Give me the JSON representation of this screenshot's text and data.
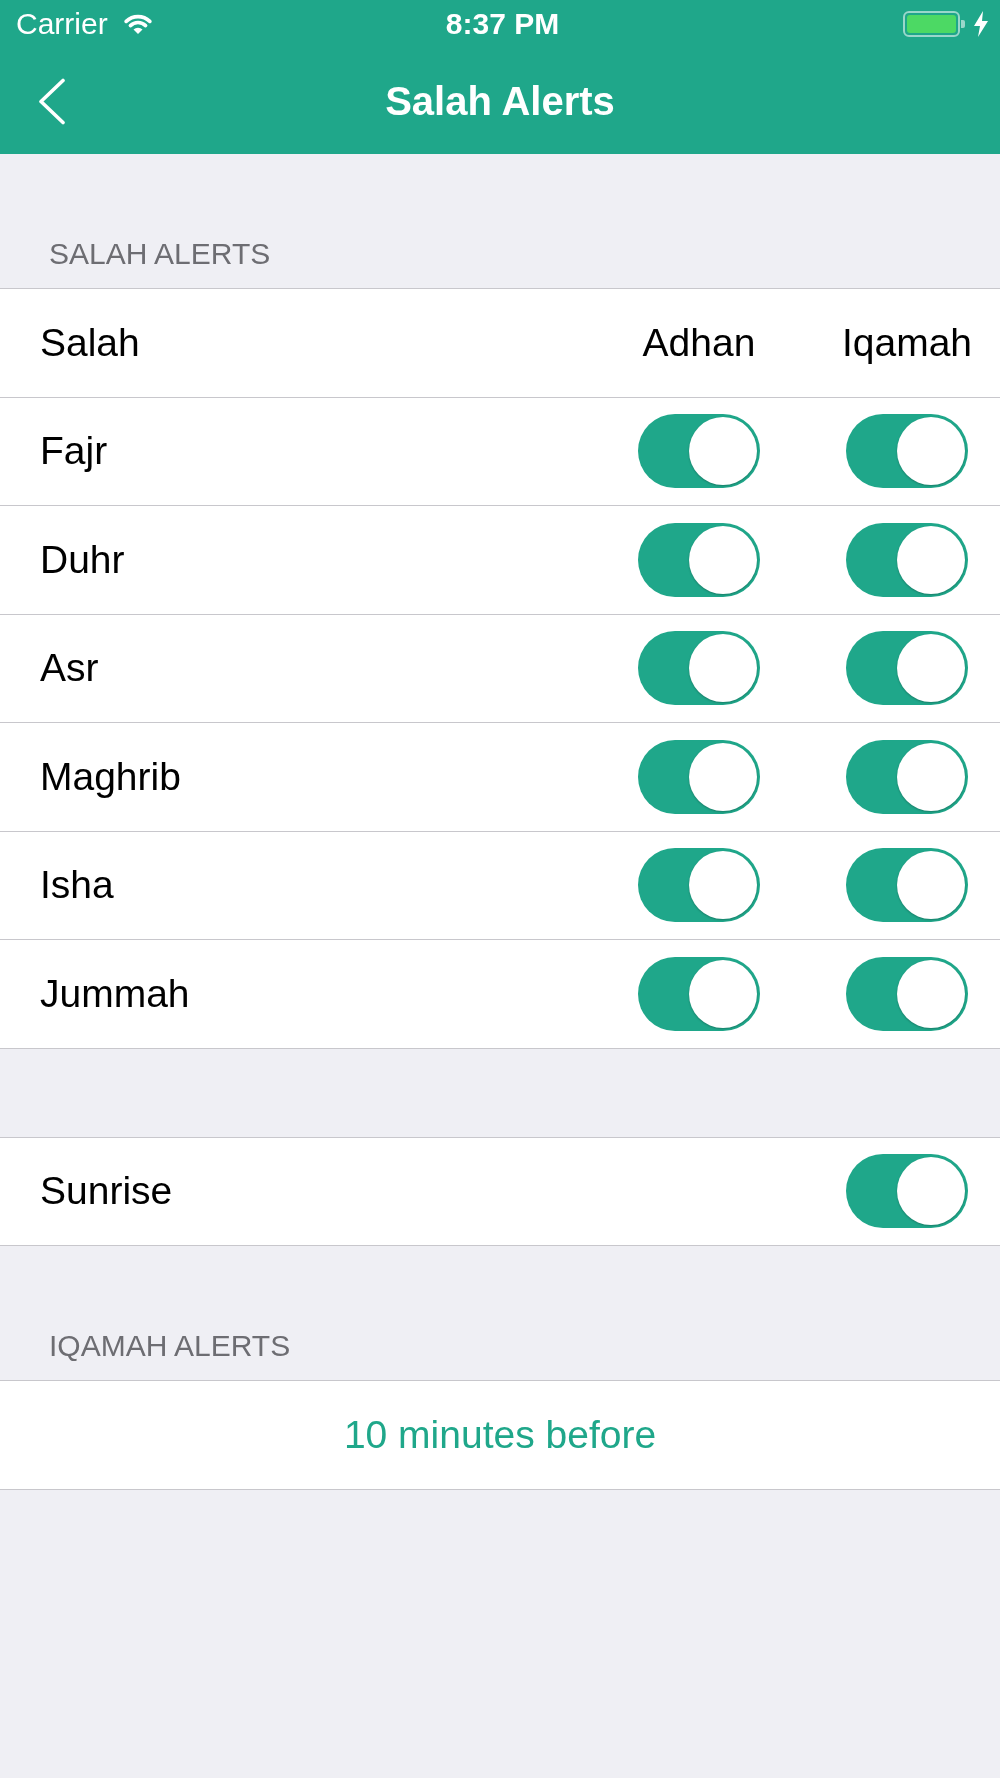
{
  "status_bar": {
    "carrier": "Carrier",
    "time": "8:37 PM",
    "charging": true
  },
  "nav_bar": {
    "title": "Salah Alerts"
  },
  "salah_alerts": {
    "header": "SALAH ALERTS",
    "columns": [
      "Salah",
      "Adhan",
      "Iqamah"
    ],
    "rows": [
      {
        "salah": "Fajr",
        "adhan_on": true,
        "iqamah_on": true
      },
      {
        "salah": "Duhr",
        "adhan_on": true,
        "iqamah_on": true
      },
      {
        "salah": "Asr",
        "adhan_on": true,
        "iqamah_on": true
      },
      {
        "salah": "Maghrib",
        "adhan_on": true,
        "iqamah_on": true
      },
      {
        "salah": "Isha",
        "adhan_on": true,
        "iqamah_on": true
      },
      {
        "salah": "Jummah",
        "adhan_on": true,
        "iqamah_on": true
      }
    ]
  },
  "sunrise": {
    "label": "Sunrise",
    "on": true
  },
  "iqamah_alerts": {
    "header": "IQAMAH ALERTS",
    "value": "10 minutes before"
  }
}
